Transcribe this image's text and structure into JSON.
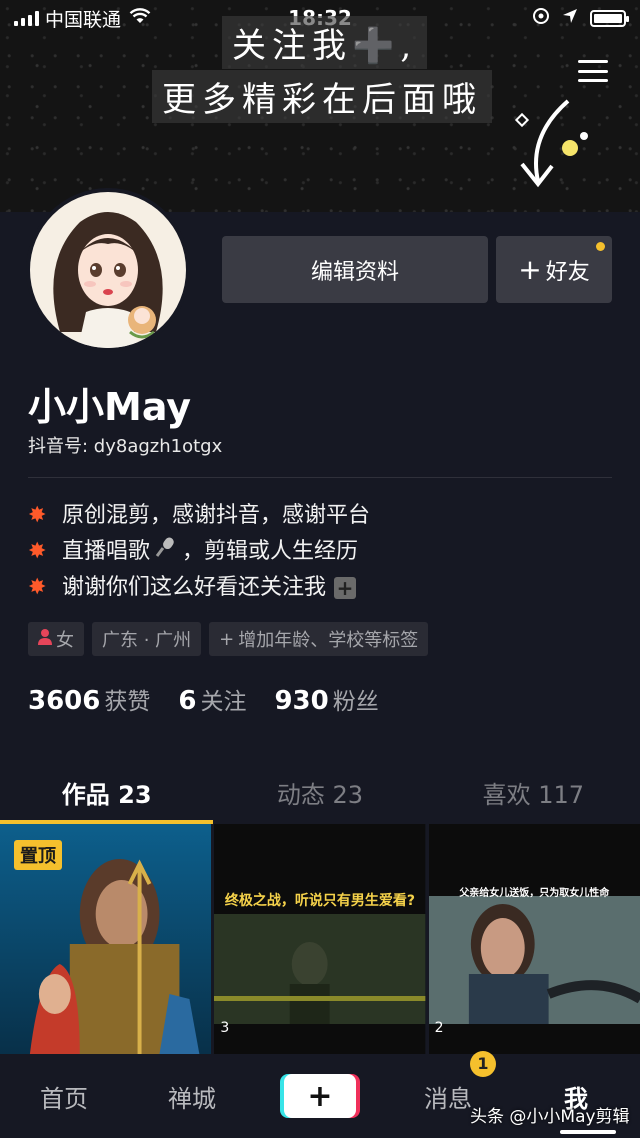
{
  "status_bar": {
    "carrier": "中国联通",
    "time": "18:32"
  },
  "banner": {
    "line1": "关注我➕,",
    "line2": "更多精彩在后面哦"
  },
  "profile": {
    "edit_label": "编辑资料",
    "friend_label": "好友",
    "name": "小小May",
    "douyin_id": "抖音号: dy8agzh1otgx",
    "bio": [
      "原创混剪，感谢抖音，感谢平台",
      "直播唱歌",
      "，剪辑或人生经历",
      "谢谢你们这么好看还关注我"
    ],
    "tags": {
      "gender": "女",
      "location": "广东 · 广州",
      "add": "增加年龄、学校等标签"
    },
    "stats": [
      {
        "num": "3606",
        "label": "获赞"
      },
      {
        "num": "6",
        "label": "关注"
      },
      {
        "num": "930",
        "label": "粉丝"
      }
    ]
  },
  "tabs": [
    {
      "label": "作品 23"
    },
    {
      "label": "动态 23"
    },
    {
      "label": "喜欢 117"
    }
  ],
  "grid": {
    "pinned_label": "置顶",
    "items": [
      {
        "count": "",
        "caption": ""
      },
      {
        "count": "3",
        "caption": "终极之战，听说只有男生爱看?"
      },
      {
        "count": "2",
        "caption": "父亲给女儿送饭，只为取女儿性命"
      }
    ]
  },
  "bottom_nav": {
    "home": "首页",
    "zen": "禅城",
    "plus": "+",
    "messages": "消息",
    "messages_badge": "1",
    "me": "我"
  },
  "watermark": "头条 @小小May剪辑",
  "colors": {
    "accent": "#f5c02d",
    "background": "#161823",
    "button": "#3a3b44"
  }
}
